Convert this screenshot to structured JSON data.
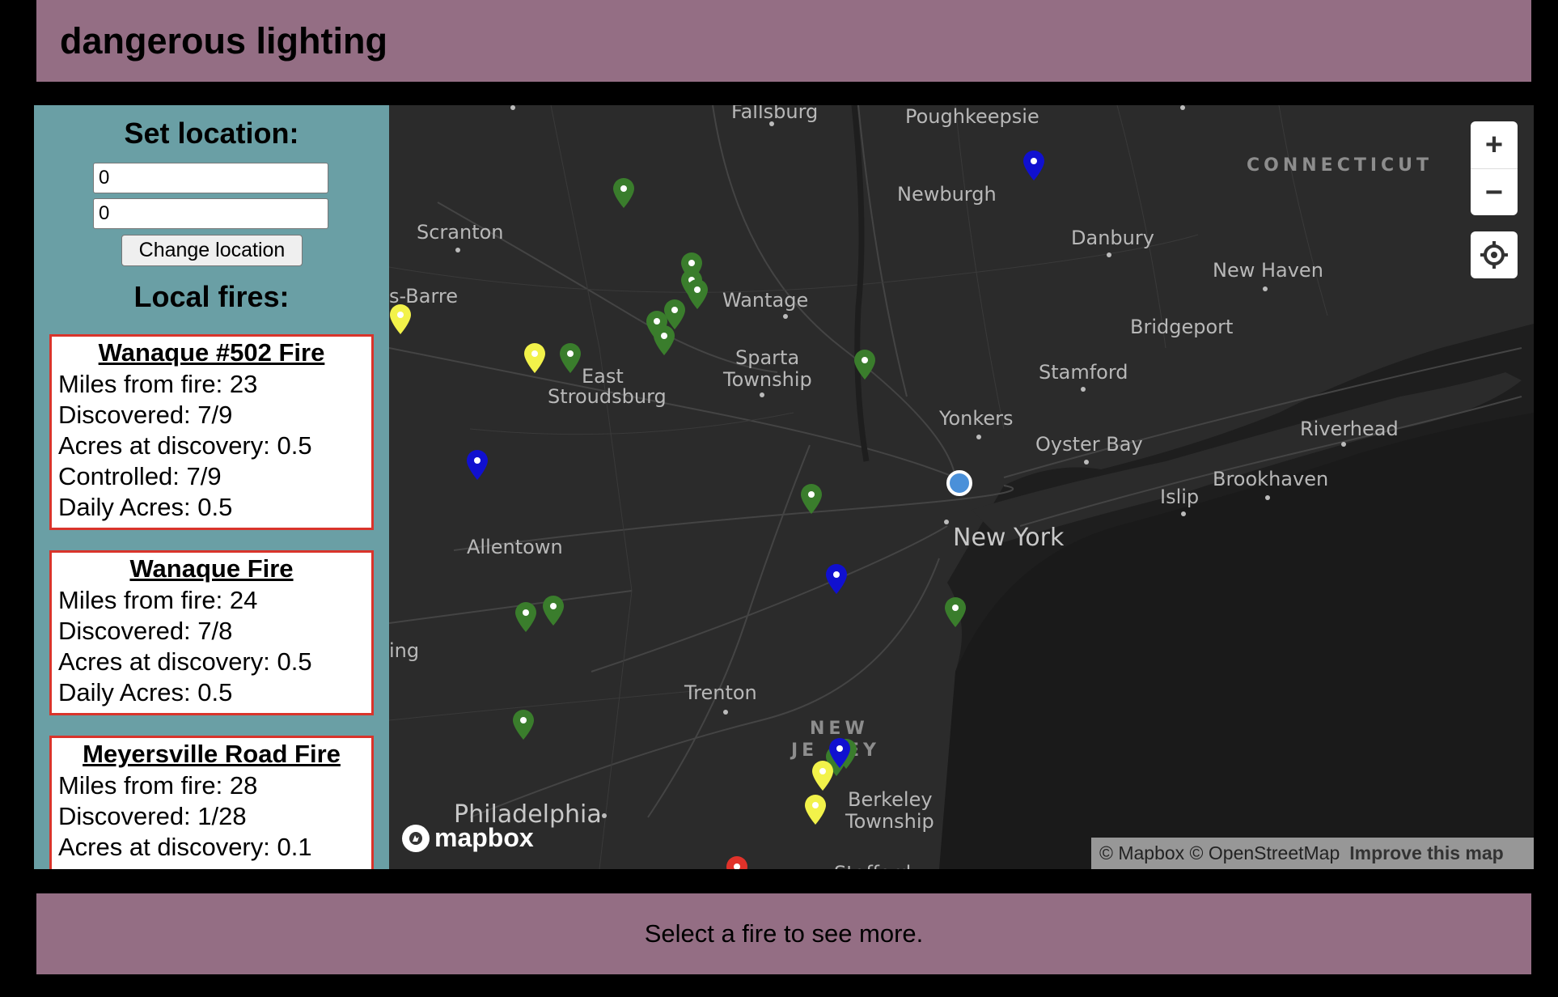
{
  "header": {
    "title": "dangerous lighting"
  },
  "sidebar": {
    "set_location_title": "Set location:",
    "lat_value": "0",
    "lon_value": "0",
    "change_button": "Change location",
    "local_fires_title": "Local fires:"
  },
  "fires": [
    {
      "name": "Wanaque #502 Fire",
      "lines": [
        "Miles from fire: 23",
        "Discovered: 7/9",
        "Acres at discovery: 0.5",
        "Controlled: 7/9",
        "Daily Acres: 0.5"
      ]
    },
    {
      "name": "Wanaque Fire",
      "lines": [
        "Miles from fire: 24",
        "Discovered: 7/8",
        "Acres at discovery: 0.5",
        "Daily Acres: 0.5"
      ]
    },
    {
      "name": "Meyersville Road Fire",
      "lines": [
        "Miles from fire: 28",
        "Discovered: 1/28",
        "Acres at discovery: 0.1"
      ]
    }
  ],
  "map": {
    "places": [
      "Fallsburg",
      "Poughkeepsie",
      "CONNECTICUT",
      "Newburgh",
      "Scranton",
      "Danbury",
      "New Haven",
      "s-Barre",
      "Wantage",
      "Bridgeport",
      "Sparta",
      "Township",
      "East",
      "Stroudsburg",
      "Stamford",
      "Yonkers",
      "Riverhead",
      "Oyster Bay",
      "Brookhaven",
      "Islip",
      "New York",
      "Allentown",
      "ing",
      "Trenton",
      "NEW",
      "JE",
      "EY",
      "Berkeley",
      "Township",
      "Philadelphia",
      "Stafford"
    ],
    "attribution": "© Mapbox © OpenStreetMap",
    "improve_link": "Improve this map",
    "logo_text": "mapbox",
    "zoom_in": "+",
    "zoom_out": "−",
    "marker_colors": {
      "green": "#3a7d2c",
      "blue": "#1010d0",
      "yellow": "#f2f24a",
      "red": "#e0322a"
    }
  },
  "footer": {
    "text": "Select a fire to see more."
  }
}
